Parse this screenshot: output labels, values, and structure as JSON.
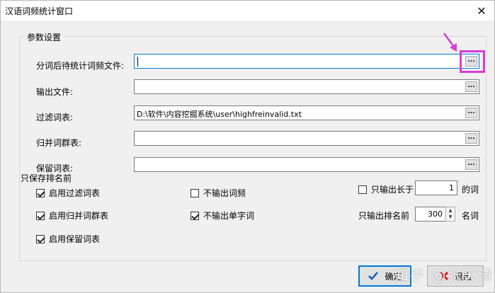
{
  "window": {
    "title": "汉语词频统计窗口",
    "close_glyph": "✕"
  },
  "group": {
    "title": "参数设置"
  },
  "fields": [
    {
      "label": "分词后待统计词频文件:",
      "value": ""
    },
    {
      "label": "输出文件:",
      "value": ""
    },
    {
      "label": "过滤词表:",
      "value": "D:\\软件\\内容挖掘系统\\user\\highfreinvalid.txt"
    },
    {
      "label": "归并词群表:",
      "value": ""
    },
    {
      "label": "保留词表:",
      "value": ""
    }
  ],
  "browse_label": "...",
  "options": {
    "section_label": "只保存排名前",
    "use_filter": {
      "label": "启用过滤词表",
      "checked": true
    },
    "use_merge": {
      "label": "启用归并词群表",
      "checked": true
    },
    "use_keep": {
      "label": "启用保留词表",
      "checked": true
    },
    "no_freq": {
      "label": "不输出词频",
      "checked": false
    },
    "no_single": {
      "label": "不输出单字词",
      "checked": true
    },
    "min_length": {
      "label": "只输出长于",
      "checked": false,
      "value": "1",
      "suffix": "的词"
    },
    "top_n": {
      "label": "只输出排名前",
      "value": "300",
      "suffix": "名词"
    }
  },
  "buttons": {
    "ok": "确定",
    "exit": "退出"
  },
  "watermark": "知乎 @张天清",
  "colors": {
    "highlight": "#d63cd6",
    "focus": "#0078d7"
  }
}
